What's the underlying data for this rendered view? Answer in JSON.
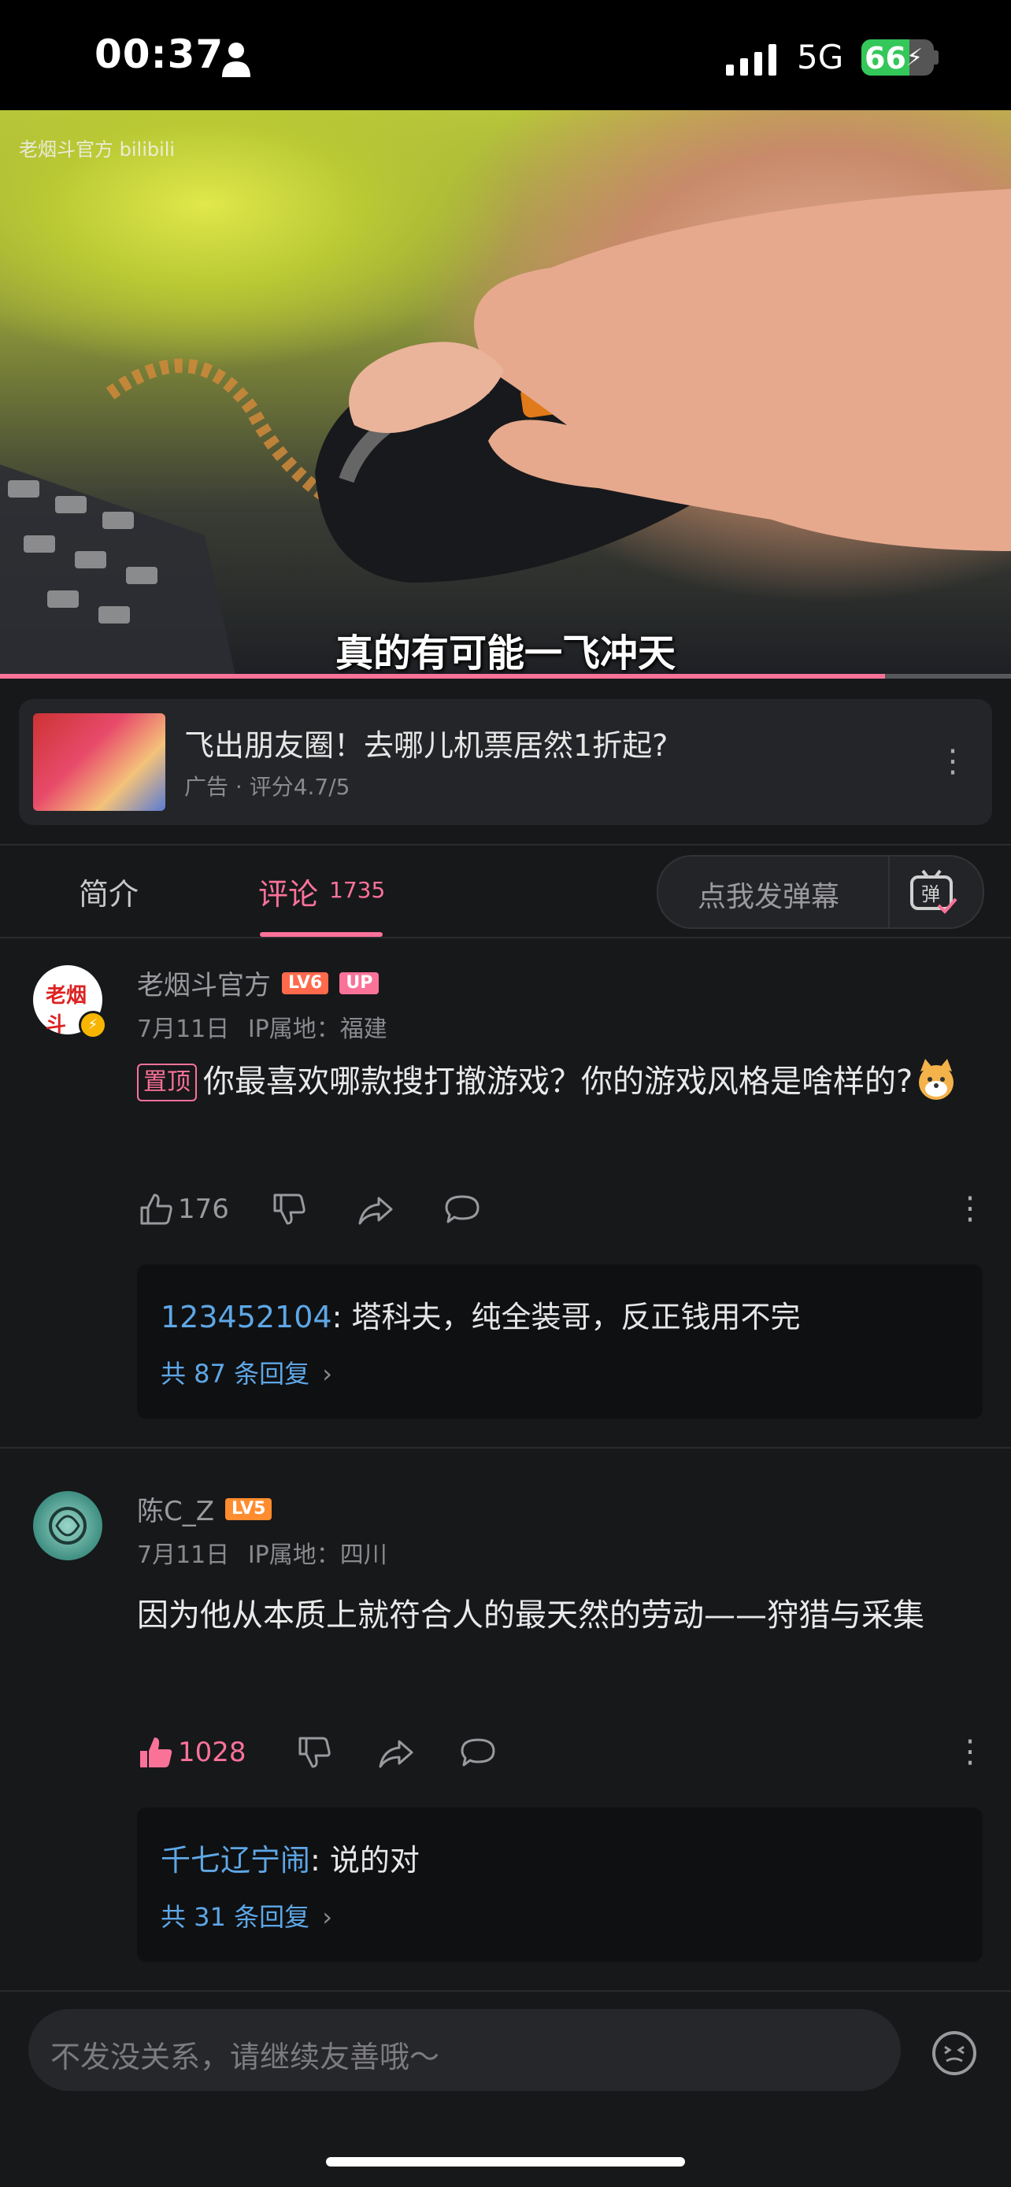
{
  "status_bar": {
    "time": "00:37",
    "network": "5G",
    "battery_percent": 66,
    "battery_label": "66"
  },
  "video": {
    "watermark": "老烟斗官方 bilibili",
    "subtitle": "真的有可能一飞冲天",
    "progress_fraction": 0.875
  },
  "ad": {
    "title": "飞出朋友圈！去哪儿机票居然1折起?",
    "subtitle": "广告 · 评分4.7/5",
    "more_icon": "more-vertical-icon"
  },
  "tabs": {
    "intro": "简介",
    "comments": "评论",
    "comments_count": "1735",
    "danmu_placeholder": "点我发弹幕",
    "danmu_icon": "danmu-toggle-icon"
  },
  "comments": [
    {
      "author": "老烟斗官方",
      "level": "LV6",
      "up_badge": "UP",
      "date": "7月11日",
      "ip": "IP属地：福建",
      "pinned_label": "置顶",
      "text": "你最喜欢哪款搜打撤游戏？你的游戏风格是啥样的?",
      "likes": "176",
      "liked": false,
      "reply_preview_user": "123452104",
      "reply_preview_text": ": 塔科夫，纯全装哥，反正钱用不完",
      "reply_total": "共 87 条回复",
      "avatar_text": "老烟斗"
    },
    {
      "author": "陈C_Z",
      "level": "LV5",
      "date": "7月11日",
      "ip": "IP属地：四川",
      "text": "因为他从本质上就符合人的最天然的劳动——狩猎与采集",
      "likes": "1028",
      "liked": true,
      "reply_preview_user": "千七辽宁闹",
      "reply_preview_text": ": 说的对",
      "reply_total": "共 31 条回复"
    }
  ],
  "bottom": {
    "input_placeholder": "不发没关系，请继续友善哦～"
  },
  "colors": {
    "accent": "#fb7299",
    "link": "#5ea7e6",
    "background": "#17181a"
  }
}
